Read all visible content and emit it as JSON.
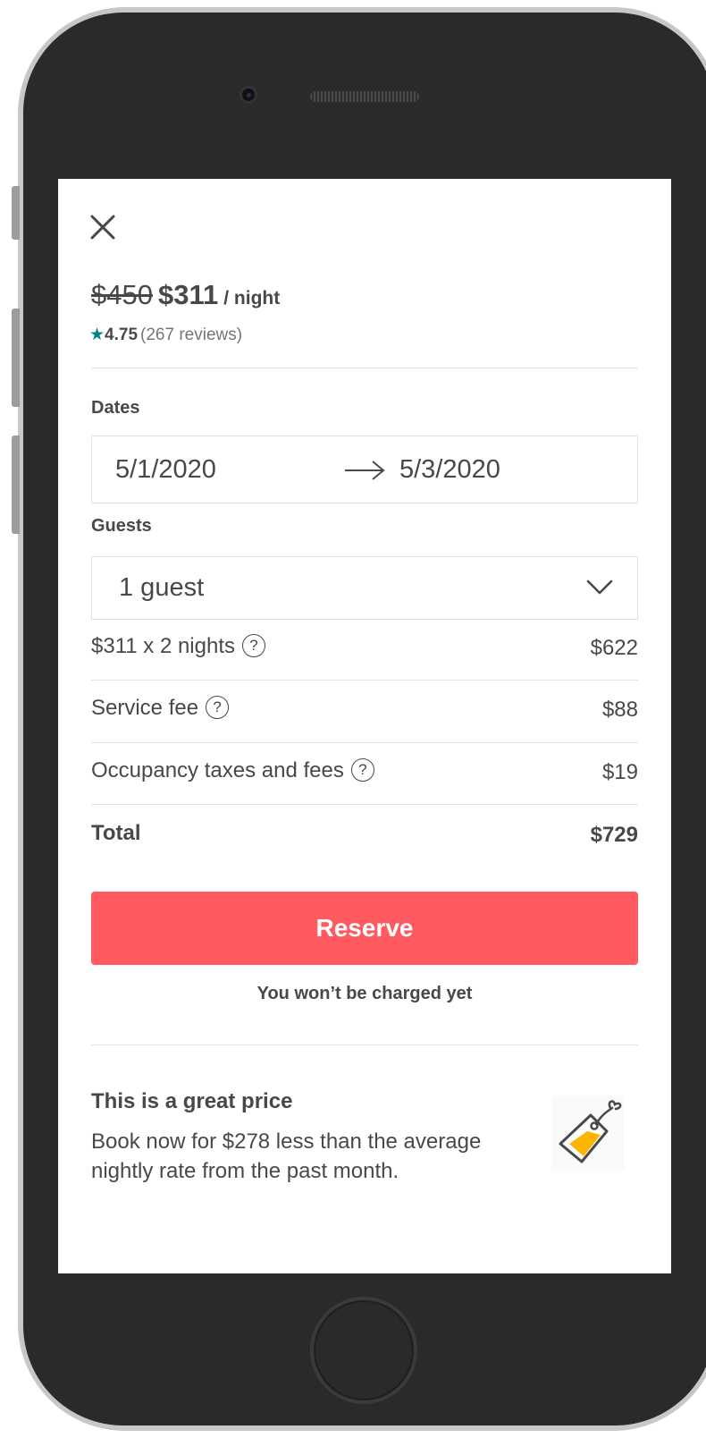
{
  "header": {
    "close_icon": "close-icon"
  },
  "pricing": {
    "original_price": "$450",
    "discounted_price": "$311",
    "per_night": "/ night",
    "rating": "4.75",
    "reviews": "(267 reviews)",
    "star_color": "#008489"
  },
  "dates": {
    "label": "Dates",
    "check_in": "5/1/2020",
    "check_out": "5/3/2020",
    "arrow_icon": "arrow-right-icon"
  },
  "guests": {
    "label": "Guests",
    "value": "1 guest",
    "chevron_icon": "chevron-down-icon"
  },
  "breakdown": [
    {
      "label": "$311 x 2 nights",
      "value": "$622",
      "help": "?"
    },
    {
      "label": "Service fee",
      "value": "$88",
      "help": "?"
    },
    {
      "label": "Occupancy taxes and fees",
      "value": "$19",
      "help": "?"
    }
  ],
  "total": {
    "label": "Total",
    "value": "$729"
  },
  "reserve": {
    "label": "Reserve",
    "note": "You won’t be charged yet",
    "button_color": "#ff5a5f"
  },
  "deal": {
    "title": "This is a great price",
    "body": "Book now for $278 less than the average nightly rate from the past month.",
    "icon": "price-tag-icon"
  }
}
